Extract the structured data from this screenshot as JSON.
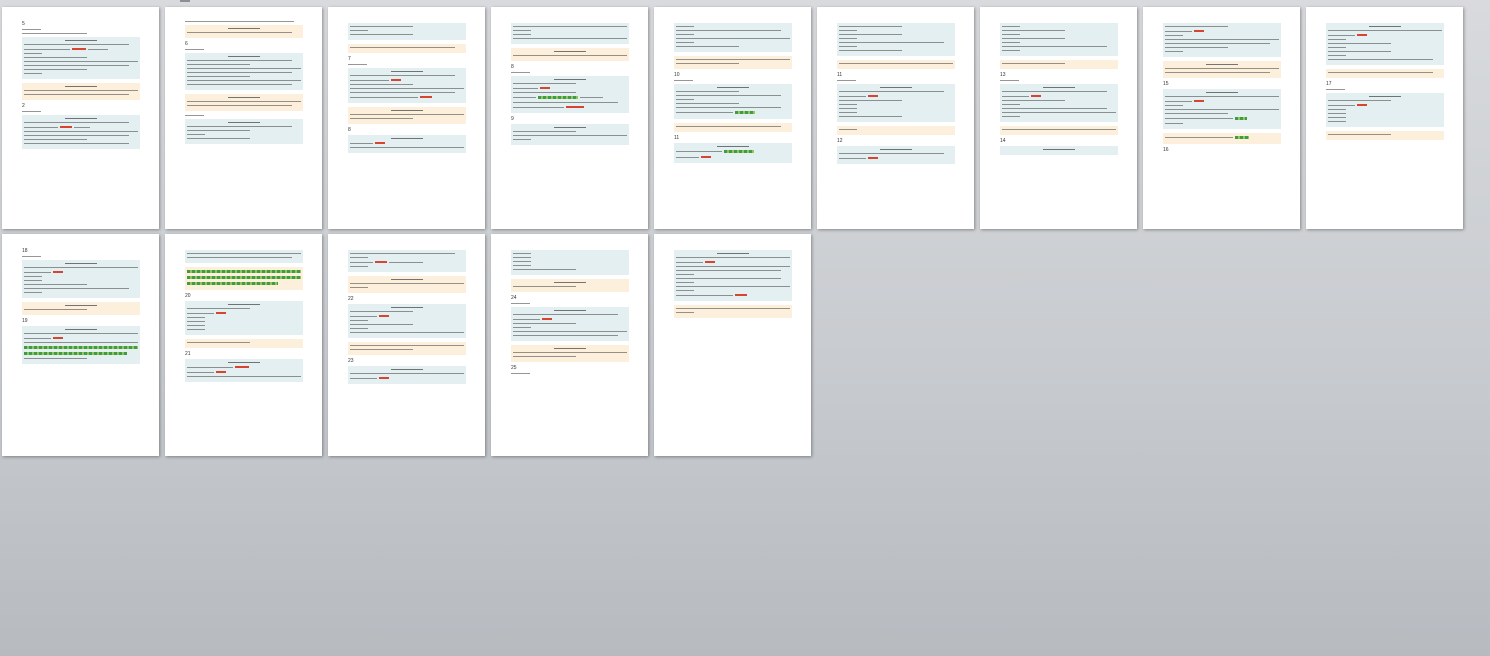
{
  "view": "document-page-thumbnail-overview",
  "pages": [
    {
      "number_marks": [
        "5",
        "2"
      ]
    },
    {
      "number_marks": [
        "6"
      ]
    },
    {
      "number_marks": [
        "7",
        "8"
      ]
    },
    {
      "number_marks": [
        "8",
        "9"
      ]
    },
    {
      "number_marks": [
        "10",
        "11"
      ]
    },
    {
      "number_marks": [
        "11",
        "12"
      ]
    },
    {
      "number_marks": [
        "13",
        "14"
      ]
    },
    {
      "number_marks": [
        "15",
        "16"
      ]
    },
    {
      "number_marks": [
        "17"
      ]
    },
    {
      "number_marks": [
        "18",
        "19"
      ]
    },
    {
      "number_marks": [
        "20",
        "21"
      ]
    },
    {
      "number_marks": [
        "22",
        "23"
      ]
    },
    {
      "number_marks": [
        "24",
        "25"
      ]
    },
    {
      "number_marks": []
    }
  ],
  "colors": {
    "workspace_background": "#c8cbcf",
    "page": "#ffffff",
    "code_block": "#e4eff1",
    "output_block": "#fcefdc",
    "plain_block": "#f4f6f7",
    "error_mark": "#d5452f",
    "ok_mark": "#3f9b46"
  }
}
